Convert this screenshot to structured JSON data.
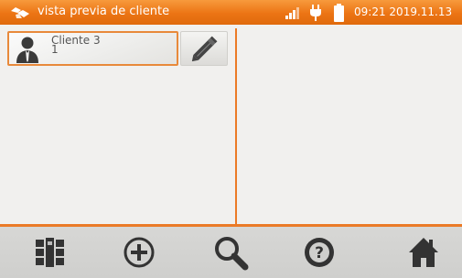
{
  "statusbar": {
    "title": "vista previa de cliente",
    "time": "09:21",
    "date": "2019.11.13",
    "logo_icon": "meter-logo-icon",
    "signal_icon": "signal-strength-icon",
    "power_icon": "power-plug-icon",
    "battery_icon": "battery-icon"
  },
  "client_list": {
    "items": [
      {
        "name": "Cliente 3",
        "id": "1",
        "icon": "person-icon"
      }
    ],
    "edit_icon": "pencil-icon"
  },
  "toolbar": {
    "items": [
      {
        "icon": "structure-icon"
      },
      {
        "icon": "add-icon"
      },
      {
        "icon": "search-icon"
      },
      {
        "icon": "help-icon"
      },
      {
        "icon": "home-icon"
      }
    ]
  },
  "colors": {
    "accent": "#eb7a26",
    "statusbar_text": "#ffffff",
    "icon_dark": "#333333"
  }
}
